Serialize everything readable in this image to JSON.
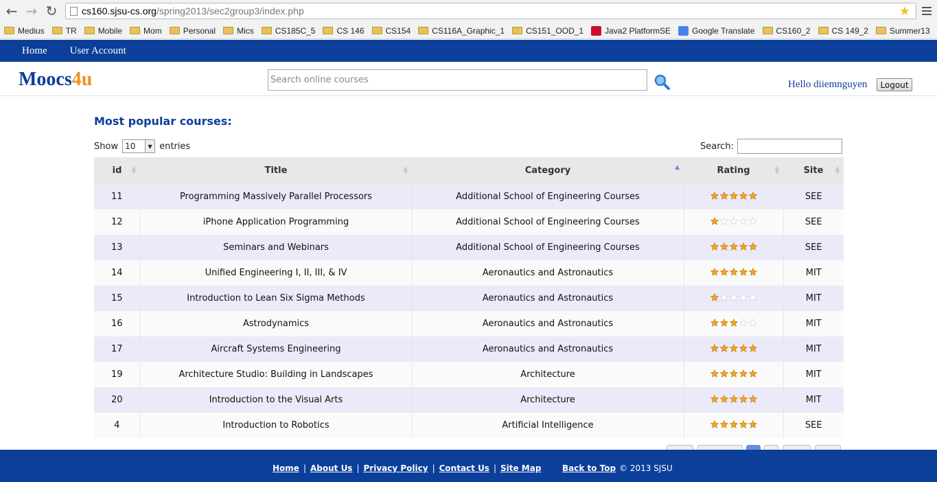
{
  "browser": {
    "url_host": "cs160.sjsu-cs.org",
    "url_path": "/spring2013/sec2group3/index.php",
    "bookmarks": [
      {
        "label": "Medius",
        "icon": "folder-icon"
      },
      {
        "label": "TR",
        "icon": "folder-icon"
      },
      {
        "label": "Mobile",
        "icon": "folder-icon"
      },
      {
        "label": "Mom",
        "icon": "folder-icon"
      },
      {
        "label": "Personal",
        "icon": "folder-icon"
      },
      {
        "label": "Mics",
        "icon": "folder-icon"
      },
      {
        "label": "CS185C_5",
        "icon": "folder-icon"
      },
      {
        "label": "CS 146",
        "icon": "folder-icon"
      },
      {
        "label": "CS154",
        "icon": "folder-icon"
      },
      {
        "label": "CS116A_Graphic_1",
        "icon": "folder-icon"
      },
      {
        "label": "CS151_OOD_1",
        "icon": "folder-icon"
      },
      {
        "label": "Java2 PlatformSE",
        "icon": "oracle-icon"
      },
      {
        "label": "Google Translate",
        "icon": "google-translate-icon"
      },
      {
        "label": "CS160_2",
        "icon": "folder-icon"
      },
      {
        "label": "CS 149_2",
        "icon": "folder-icon"
      },
      {
        "label": "Summer13",
        "icon": "folder-icon"
      }
    ]
  },
  "site_nav": {
    "home": "Home",
    "account": "User Account"
  },
  "header": {
    "logo_part1": "Moocs",
    "logo_part2": "4u",
    "search_placeholder": "Search online courses",
    "greeting": "Hello diiemnguyen",
    "logout": "Logout"
  },
  "main": {
    "title": "Most popular courses:",
    "show_label": "Show",
    "entries_label": "entries",
    "page_size": "10",
    "search_label": "Search:",
    "columns": [
      "id",
      "Title",
      "Category",
      "Rating",
      "Site"
    ],
    "rows": [
      {
        "id": "11",
        "title": "Programming Massively Parallel Processors",
        "category": "Additional School of Engineering Courses",
        "rating": 5,
        "site": "SEE"
      },
      {
        "id": "12",
        "title": "iPhone Application Programming",
        "category": "Additional School of Engineering Courses",
        "rating": 1,
        "site": "SEE"
      },
      {
        "id": "13",
        "title": "Seminars and Webinars",
        "category": "Additional School of Engineering Courses",
        "rating": 5,
        "site": "SEE"
      },
      {
        "id": "14",
        "title": "Unified Engineering I, II, III, & IV",
        "category": "Aeronautics and Astronautics",
        "rating": 5,
        "site": "MIT"
      },
      {
        "id": "15",
        "title": "Introduction to Lean Six Sigma Methods",
        "category": "Aeronautics and Astronautics",
        "rating": 1,
        "site": "MIT"
      },
      {
        "id": "16",
        "title": "Astrodynamics",
        "category": "Aeronautics and Astronautics",
        "rating": 3,
        "site": "MIT"
      },
      {
        "id": "17",
        "title": "Aircraft Systems Engineering",
        "category": "Aeronautics and Astronautics",
        "rating": 5,
        "site": "MIT"
      },
      {
        "id": "19",
        "title": "Architecture Studio: Building in Landscapes",
        "category": "Architecture",
        "rating": 5,
        "site": "MIT"
      },
      {
        "id": "20",
        "title": "Introduction to the Visual Arts",
        "category": "Architecture",
        "rating": 5,
        "site": "MIT"
      },
      {
        "id": "4",
        "title": "Introduction to Robotics",
        "category": "Artificial Intelligence",
        "rating": 5,
        "site": "SEE"
      }
    ]
  },
  "footer": {
    "links": [
      "Home",
      "About Us",
      "Privacy Policy",
      "Contact Us",
      "Site Map"
    ],
    "back_to_top": "Back to Top",
    "copyright": "© 2013 SJSU"
  },
  "colors": {
    "brand_blue": "#0b3f9a",
    "brand_orange": "#f0901e",
    "star_filled": "#f5a623",
    "star_empty": "#d9d9d9"
  }
}
